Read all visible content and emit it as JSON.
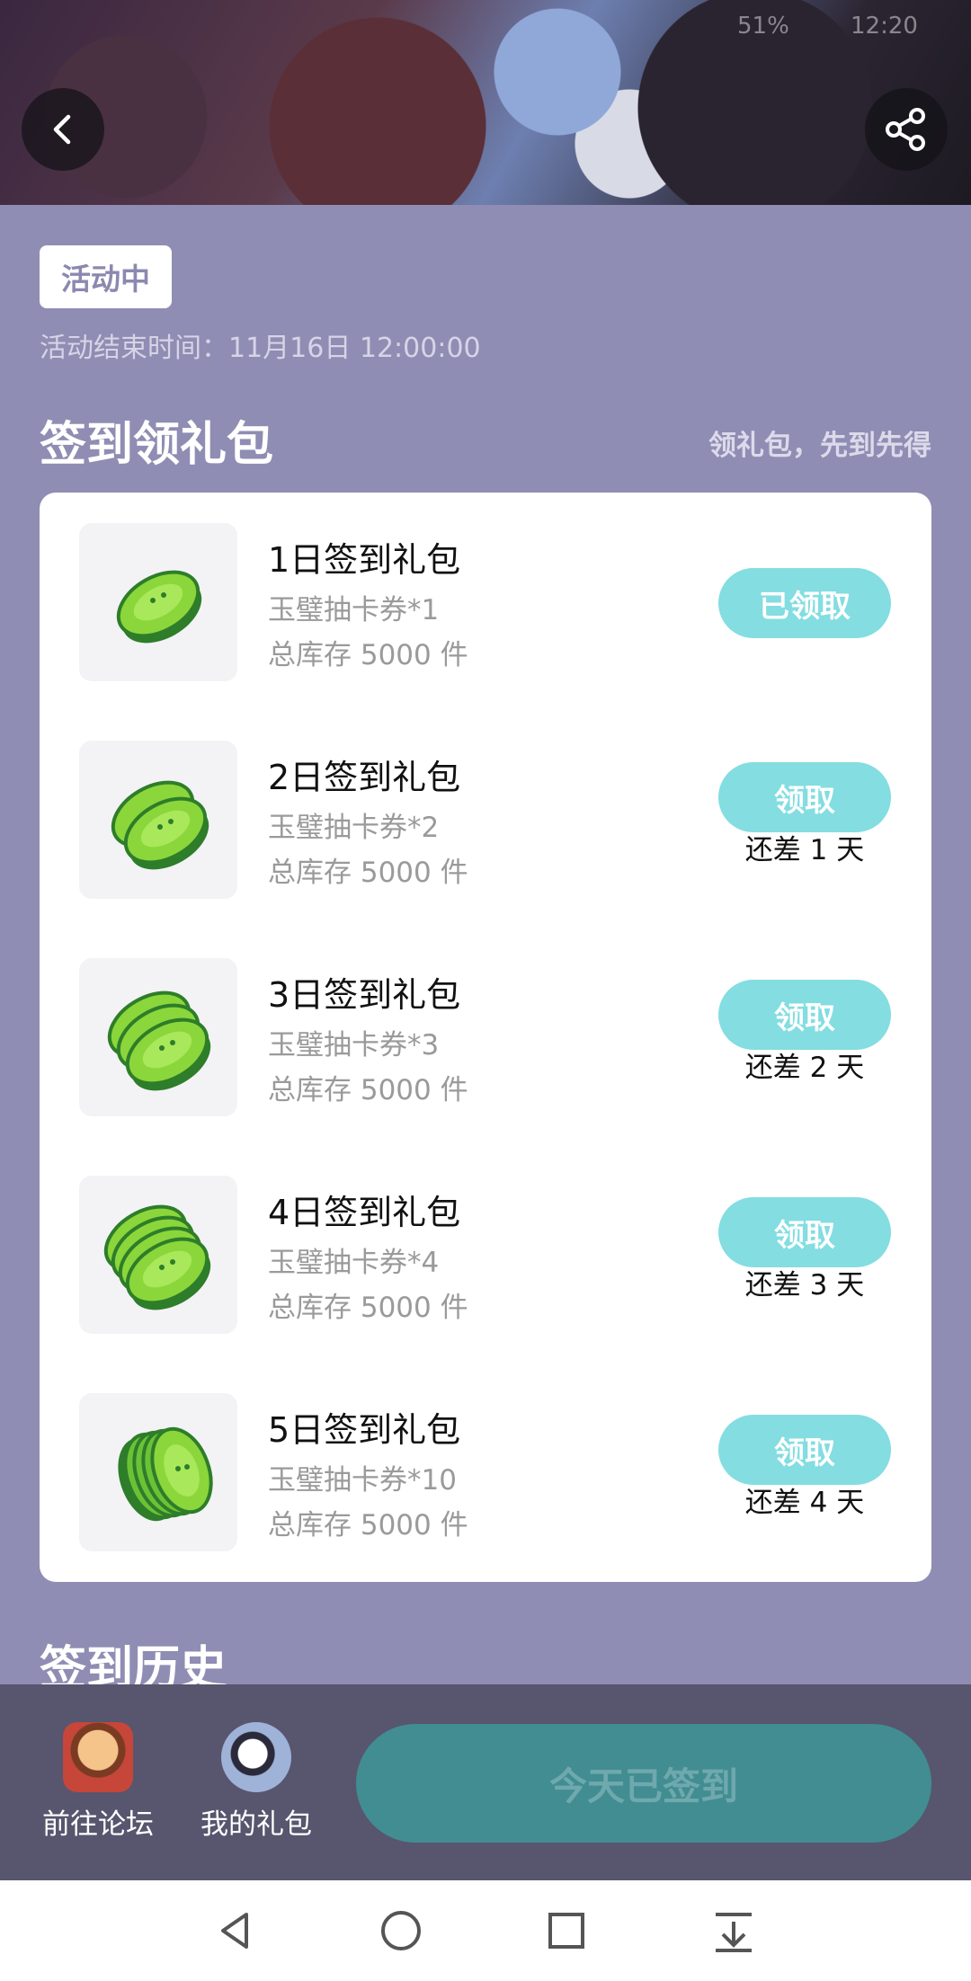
{
  "status_bar": {
    "battery": "51%",
    "time": "12:20"
  },
  "activity": {
    "status_chip": "活动中",
    "end_time": "活动结束时间：11月16日 12:00:00"
  },
  "signin_section": {
    "title": "签到领礼包",
    "subtitle": "领礼包，先到先得",
    "gifts": [
      {
        "title": "1日签到礼包",
        "desc": "玉璧抽卡券*1",
        "stock": "总库存 5000 件",
        "button": "已领取",
        "remain": ""
      },
      {
        "title": "2日签到礼包",
        "desc": "玉璧抽卡券*2",
        "stock": "总库存 5000 件",
        "button": "领取",
        "remain": "还差 1 天"
      },
      {
        "title": "3日签到礼包",
        "desc": "玉璧抽卡券*3",
        "stock": "总库存 5000 件",
        "button": "领取",
        "remain": "还差 2 天"
      },
      {
        "title": "4日签到礼包",
        "desc": "玉璧抽卡券*4",
        "stock": "总库存 5000 件",
        "button": "领取",
        "remain": "还差 3 天"
      },
      {
        "title": "5日签到礼包",
        "desc": "玉璧抽卡券*10",
        "stock": "总库存 5000 件",
        "button": "领取",
        "remain": "还差 4 天"
      }
    ]
  },
  "history_section": {
    "title": "签到历史"
  },
  "bottom_bar": {
    "forum_label": "前往论坛",
    "gifts_label": "我的礼包",
    "signed_button": "今天已签到"
  },
  "icons": {
    "back": "chevron-left-icon",
    "share": "share-icon",
    "coupon": "jade-coupon-icon",
    "nav_back": "triangle-back-icon",
    "nav_home": "circle-home-icon",
    "nav_recent": "square-recent-icon",
    "nav_notifications": "pull-down-icon"
  },
  "colors": {
    "page_bg": "#8f8db3",
    "accent_button": "#83dde1",
    "signed_button": "#418d92",
    "bottom_bar": "#58556e"
  }
}
